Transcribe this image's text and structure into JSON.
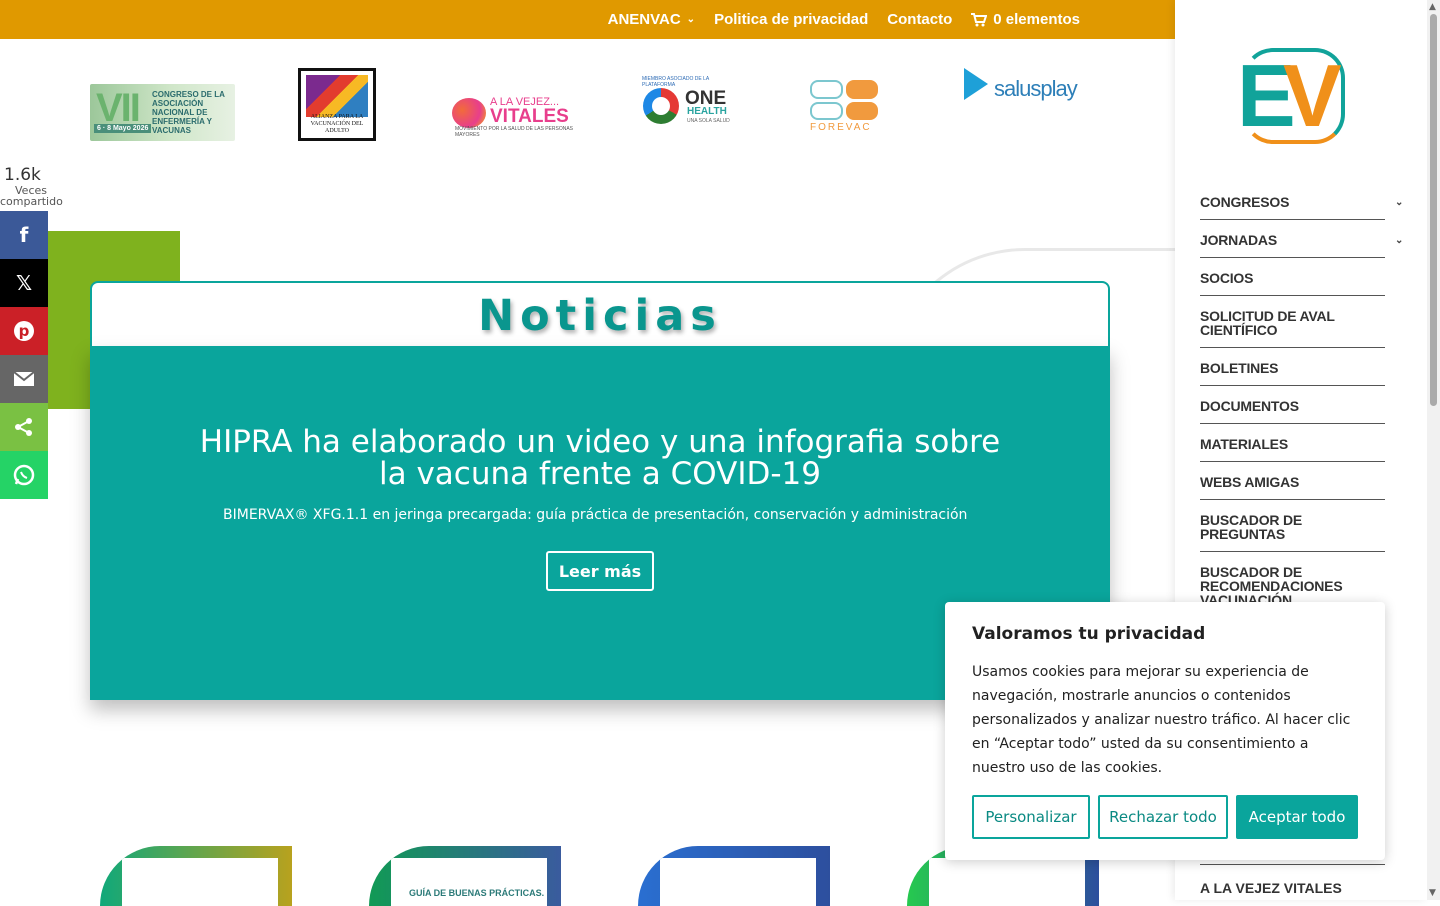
{
  "topbar": {
    "items": [
      "ANENVAC",
      "Politica de privacidad",
      "Contacto",
      "0 elementos"
    ]
  },
  "logos": {
    "vii_big": "VII",
    "vii_text": "CONGRESO DE LA ASOCIACIÓN NACIONAL DE ENFERMERÍA Y VACUNAS",
    "vii_date": "6 · 8 Mayo 2026",
    "alianza_text": "ALIANZA PARA LA VACUNACIÓN DEL ADULTO",
    "vitales_a": "A LA VEJEZ...",
    "vitales_v": "VITALES",
    "vitales_sub": "MOVIMIENTO POR LA SALUD DE LAS PERSONAS MAYORES",
    "onehealth_top": "MIEMBRO ASOCIADO DE LA PLATAFORMA",
    "onehealth_one": "ONE",
    "onehealth_health": "HEALTH",
    "onehealth_sub": "UNA SOLA SALUD",
    "forevac": "FOREVAC",
    "salus": "salusplay"
  },
  "share": {
    "count": "1.6k",
    "label": "Veces compartido"
  },
  "hero": {
    "heading": "Noticias",
    "title": "HIPRA ha elaborado un video y una infografia sobre la vacuna frente a COVID-19",
    "subtitle": "BIMERVAX® XFG.1.1 en jeringa precargada: guía práctica de presentación, conservación y administración",
    "button": "Leer más"
  },
  "cards": {
    "c2_caption": "GUÍA DE BUENAS PRÁCTICAS."
  },
  "sidebar": {
    "logo_e": "E",
    "logo_v": "V",
    "menu": [
      "CONGRESOS",
      "JORNADAS",
      "SOCIOS",
      "SOLICITUD DE AVAL CIENTÍFICO",
      "BOLETINES",
      "DOCUMENTOS",
      "MATERIALES",
      "WEBS AMIGAS",
      "BUSCADOR DE PREGUNTAS",
      "BUSCADOR DE RECOMENDACIONES VACUNACIÓN"
    ],
    "last_item": "A LA VEJEZ VITALES"
  },
  "cookie": {
    "title": "Valoramos tu privacidad",
    "text": "Usamos cookies para mejorar su experiencia de navegación, mostrarle anuncios o contenidos personalizados y analizar nuestro tráfico. Al hacer clic en “Aceptar todo” usted da su consentimiento a nuestro uso de las cookies.",
    "customize": "Personalizar",
    "reject": "Rechazar todo",
    "accept": "Aceptar todo"
  },
  "colors": {
    "topbar": "#e09900",
    "teal": "#0aa59c",
    "green_block": "#7fb21e"
  }
}
